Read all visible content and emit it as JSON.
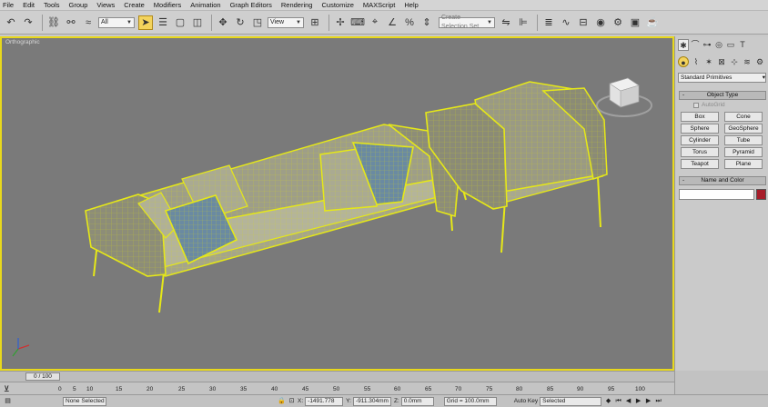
{
  "menu": [
    "File",
    "Edit",
    "Tools",
    "Group",
    "Views",
    "Create",
    "Modifiers",
    "Animation",
    "Graph Editors",
    "Rendering",
    "Customize",
    "MAXScript",
    "Help"
  ],
  "toolbar": {
    "selection_filter": "All",
    "reference_coord": "View",
    "named_selection": "Create Selection Set"
  },
  "viewport": {
    "label": "Orthographic",
    "wire_color": "#e6e818",
    "bg_color": "#7a7a7a",
    "active_border_color": "#e8d81c"
  },
  "command_panel": {
    "category": "Standard Primitives",
    "object_type_header": "Object Type",
    "autogrid_label": "AutoGrid",
    "buttons": [
      "Box",
      "Cone",
      "Sphere",
      "GeoSphere",
      "Cylinder",
      "Tube",
      "Torus",
      "Pyramid",
      "Teapot",
      "Plane"
    ],
    "name_color_header": "Name and Color",
    "color_swatch": "#a71d2a"
  },
  "timeline": {
    "slider_label": "0 / 100",
    "ticks": [
      "0",
      "5",
      "10",
      "15",
      "20",
      "25",
      "30",
      "35",
      "40",
      "45",
      "50",
      "55",
      "60",
      "65",
      "70",
      "75",
      "80",
      "85",
      "90",
      "95",
      "100"
    ]
  },
  "status": {
    "selection": "None Selected",
    "x_label": "X:",
    "x_value": "-1491.778",
    "y_label": "Y:",
    "y_value": "-911.304mm",
    "z_label": "Z:",
    "z_value": "0.0mm",
    "grid": "Grid = 100.0mm",
    "autokey_label": "Auto Key",
    "autokey_value": "Selected"
  }
}
